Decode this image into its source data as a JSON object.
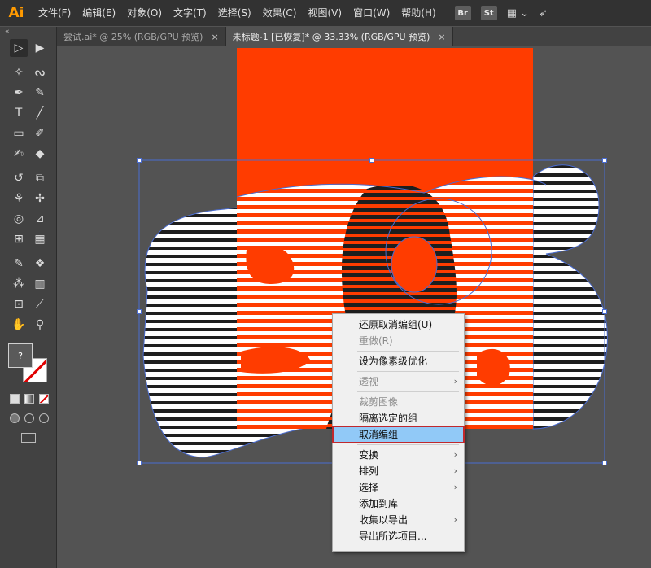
{
  "app": {
    "logo": "Ai"
  },
  "menubar": {
    "items": [
      "文件(F)",
      "编辑(E)",
      "对象(O)",
      "文字(T)",
      "选择(S)",
      "效果(C)",
      "视图(V)",
      "窗口(W)",
      "帮助(H)"
    ],
    "bridge_label": "Br",
    "stock_label": "St",
    "workspace_icon": "grid-layout-icon",
    "gpu_icon": "rocket-icon"
  },
  "tabs": [
    {
      "label": "尝试.ai* @ 25% (RGB/GPU 预览)",
      "close": "×",
      "active": false
    },
    {
      "label": "未标题-1 [已恢复]* @ 33.33% (RGB/GPU 预览)",
      "close": "×",
      "active": true
    }
  ],
  "toolbar": {
    "collapse": "«",
    "tools": [
      [
        "selection-tool",
        "direct-selection-tool"
      ],
      [
        "magic-wand-tool",
        "lasso-tool"
      ],
      [
        "pen-tool",
        "curvature-tool"
      ],
      [
        "type-tool",
        "line-tool"
      ],
      [
        "rectangle-tool",
        "paintbrush-tool"
      ],
      [
        "shaper-tool",
        "eraser-tool"
      ],
      [
        "rotate-tool",
        "scale-tool"
      ],
      [
        "width-tool",
        "puppet-warp-tool"
      ],
      [
        "shape-builder-tool",
        "perspective-grid-tool"
      ],
      [
        "mesh-tool",
        "gradient-tool"
      ],
      [
        "eyedropper-tool",
        "blend-tool"
      ],
      [
        "symbol-sprayer-tool",
        "column-graph-tool"
      ],
      [
        "artboard-tool",
        "slice-tool"
      ],
      [
        "hand-tool",
        "zoom-tool"
      ]
    ],
    "tool_glyphs": [
      [
        "▷",
        "▶"
      ],
      [
        "✧",
        "ᔓ"
      ],
      [
        "✒",
        "✎"
      ],
      [
        "T",
        "╱"
      ],
      [
        "▭",
        "✐"
      ],
      [
        "✍",
        "◆"
      ],
      [
        "↺",
        "⧉"
      ],
      [
        "⚘",
        "✢"
      ],
      [
        "◎",
        "⊿"
      ],
      [
        "⊞",
        "▦"
      ],
      [
        "✎",
        "❖"
      ],
      [
        "⁂",
        "▥"
      ],
      [
        "⊡",
        "⟋"
      ],
      [
        "✋",
        "⚲"
      ]
    ],
    "fill_label": "?"
  },
  "canvas": {
    "artboard_color": "#ff3c00",
    "stripe_color_dark": "#1e1e1e",
    "stripe_color_light": "#ffffff",
    "bbox_color": "#4a6cd0"
  },
  "context_menu": {
    "items": [
      {
        "label": "还原取消编组(U)",
        "state": "normal",
        "submenu": false
      },
      {
        "label": "重做(R)",
        "state": "disabled",
        "submenu": false
      },
      {
        "sep": true
      },
      {
        "label": "设为像素级优化",
        "state": "normal",
        "submenu": false
      },
      {
        "sep": true
      },
      {
        "label": "透视",
        "state": "disabled",
        "submenu": true
      },
      {
        "sep": true
      },
      {
        "label": "裁剪图像",
        "state": "disabled",
        "submenu": false
      },
      {
        "label": "隔离选定的组",
        "state": "normal",
        "submenu": false
      },
      {
        "label": "取消编组",
        "state": "highlight",
        "submenu": false
      },
      {
        "sep": true
      },
      {
        "label": "变换",
        "state": "normal",
        "submenu": true
      },
      {
        "label": "排列",
        "state": "normal",
        "submenu": true
      },
      {
        "label": "选择",
        "state": "normal",
        "submenu": true
      },
      {
        "label": "添加到库",
        "state": "normal",
        "submenu": false
      },
      {
        "label": "收集以导出",
        "state": "normal",
        "submenu": true
      },
      {
        "label": "导出所选项目...",
        "state": "normal",
        "submenu": false
      }
    ],
    "submenu_arrow": "›"
  }
}
